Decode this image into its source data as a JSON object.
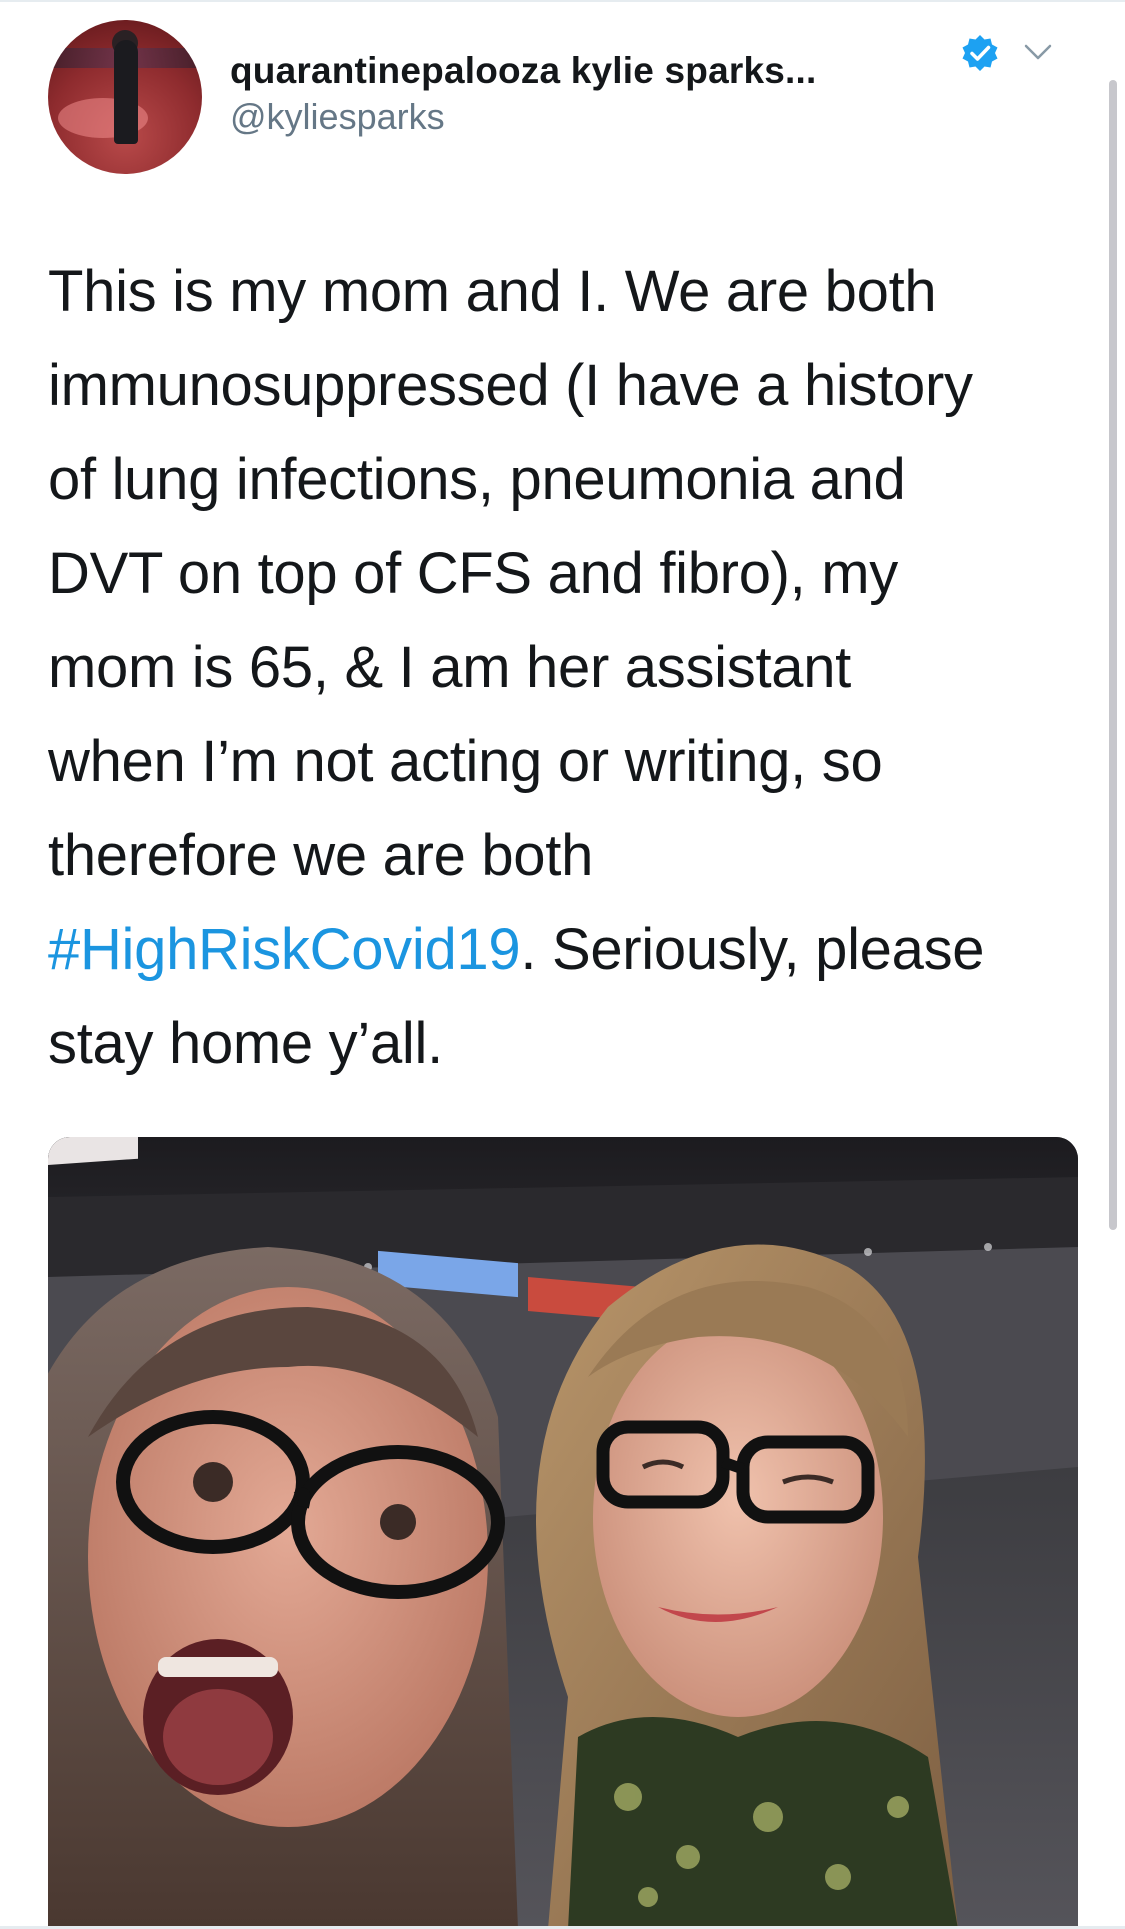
{
  "user": {
    "display_name": "quarantinepalooza kylie sparks...",
    "handle": "@kyliesparks",
    "verified": true,
    "verified_icon": "verified-badge-icon",
    "menu_icon": "chevron-down-icon"
  },
  "tweet": {
    "lines": [
      "This is my mom and I.  We are both",
      "immunosuppressed (I have a history",
      "of lung infections, pneumonia and",
      "DVT on top of CFS and fibro), my",
      "mom is 65, & I am her assistant",
      "when I’m not acting or writing, so",
      "therefore we are both"
    ],
    "hashtag": "#HighRiskCovid19",
    "after_hashtag": ".  Seriously, please",
    "last_line": "stay home y’all."
  },
  "colors": {
    "text": "#14171a",
    "secondary": "#657786",
    "link": "#1b95e0",
    "verified": "#1da1f2"
  }
}
